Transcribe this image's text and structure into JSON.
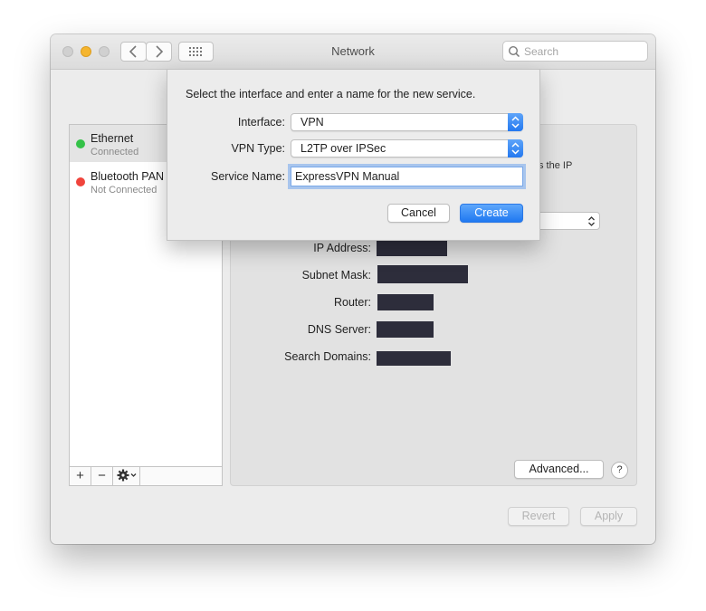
{
  "window": {
    "title": "Network",
    "search_placeholder": "Search"
  },
  "services": [
    {
      "name": "Ethernet",
      "status": "Connected",
      "color": "#34c248"
    },
    {
      "name": "Bluetooth PAN",
      "status": "Not Connected",
      "color": "#f0443c"
    }
  ],
  "sidebar_controls": {
    "add": "+",
    "remove": "−"
  },
  "details": {
    "partial_text": "s the IP",
    "fields": [
      {
        "label": "IP Address:"
      },
      {
        "label": "Subnet Mask:"
      },
      {
        "label": "Router:"
      },
      {
        "label": "DNS Server:"
      },
      {
        "label": "Search Domains:"
      }
    ],
    "advanced_label": "Advanced...",
    "help_label": "?"
  },
  "footer": {
    "revert_label": "Revert",
    "apply_label": "Apply"
  },
  "sheet": {
    "prompt": "Select the interface and enter a name for the new service.",
    "interface": {
      "label": "Interface:",
      "value": "VPN"
    },
    "vpn_type": {
      "label": "VPN Type:",
      "value": "L2TP over IPSec"
    },
    "service_name": {
      "label": "Service Name:",
      "value": "ExpressVPN Manual"
    },
    "cancel_label": "Cancel",
    "create_label": "Create"
  },
  "colors": {
    "accent": "#2479f0",
    "close": "#cfcfcf",
    "minimize": "#f5b52e",
    "zoom": "#cfcfcf"
  }
}
